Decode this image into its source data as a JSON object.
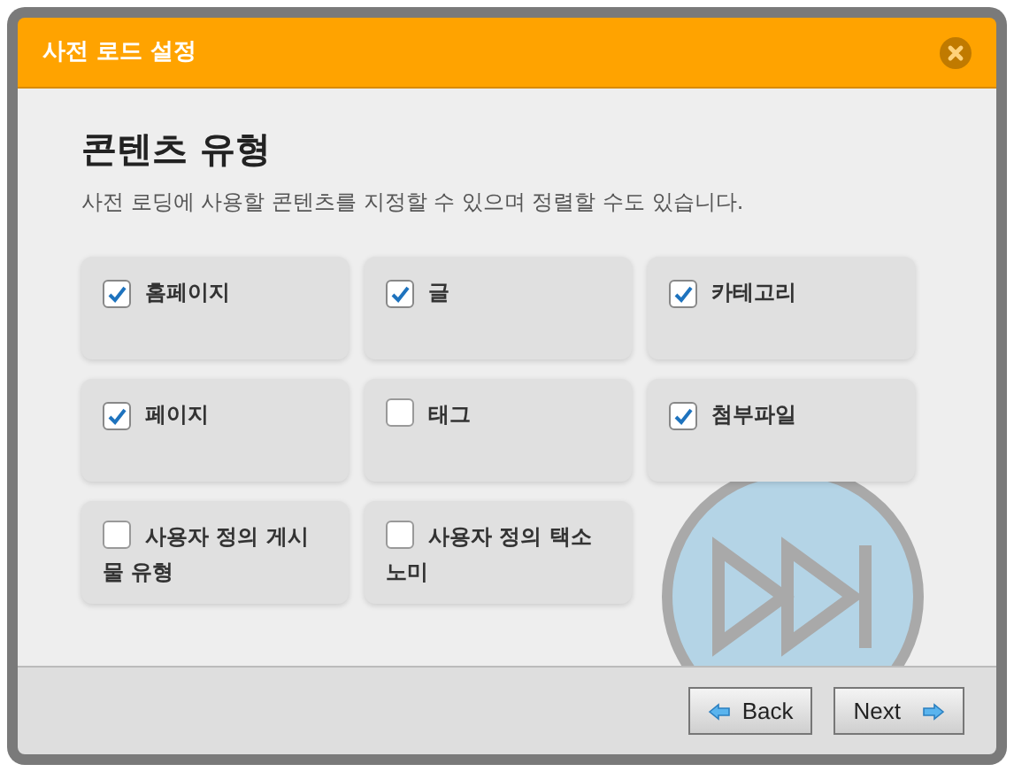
{
  "dialog": {
    "title": "사전 로드 설정"
  },
  "heading": "콘텐츠 유형",
  "description": "사전 로딩에 사용할 콘텐츠를 지정할 수 있으며 정렬할 수도 있습니다.",
  "options": [
    {
      "label": "홈페이지",
      "checked": true
    },
    {
      "label": "글",
      "checked": true
    },
    {
      "label": "카테고리",
      "checked": true
    },
    {
      "label": "페이지",
      "checked": true
    },
    {
      "label": "태그",
      "checked": false
    },
    {
      "label": "첨부파일",
      "checked": true
    },
    {
      "label": "사용자 정의 게시물 유형",
      "checked": false
    },
    {
      "label": "사용자 정의 택소노미",
      "checked": false
    }
  ],
  "buttons": [
    {
      "label": "Back",
      "kind": "back"
    },
    {
      "label": "Next",
      "kind": "next"
    }
  ]
}
